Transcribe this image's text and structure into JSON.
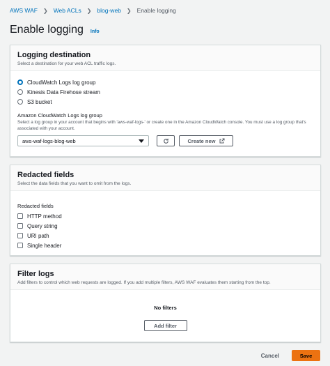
{
  "breadcrumb": {
    "items": [
      "AWS WAF",
      "Web ACLs",
      "blog-web"
    ],
    "current": "Enable logging"
  },
  "page": {
    "title": "Enable logging",
    "info_label": "Info"
  },
  "logging_destination": {
    "title": "Logging destination",
    "description": "Select a destination for your web ACL traffic logs.",
    "options": [
      {
        "label": "CloudWatch Logs log group",
        "selected": true
      },
      {
        "label": "Kinesis Data Firehose stream",
        "selected": false
      },
      {
        "label": "S3 bucket",
        "selected": false
      }
    ],
    "log_group": {
      "label": "Amazon CloudWatch Logs log group",
      "description": "Select a log group in your account that begins with 'aws-waf-logs-' or create one in the Amazon CloudWatch console. You must use a log group that's associated with your account.",
      "selected_value": "aws-waf-logs-blog-web",
      "refresh_icon": "refresh-icon",
      "create_label": "Create new",
      "create_icon": "external-link-icon"
    }
  },
  "redacted_fields": {
    "title": "Redacted fields",
    "description": "Select the data fields that you want to omit from the logs.",
    "group_label": "Redacted fields",
    "options": [
      {
        "label": "HTTP method",
        "checked": false
      },
      {
        "label": "Query string",
        "checked": false
      },
      {
        "label": "URI path",
        "checked": false
      },
      {
        "label": "Single header",
        "checked": false
      }
    ]
  },
  "filter_logs": {
    "title": "Filter logs",
    "description": "Add filters to control which web requests are logged. If you add multiple filters, AWS WAF evaluates them starting from the top.",
    "empty_text": "No filters",
    "add_label": "Add filter"
  },
  "footer": {
    "cancel_label": "Cancel",
    "save_label": "Save"
  },
  "colors": {
    "link": "#0073bb",
    "primary_button": "#ec7211",
    "background": "#f2f3f3"
  }
}
